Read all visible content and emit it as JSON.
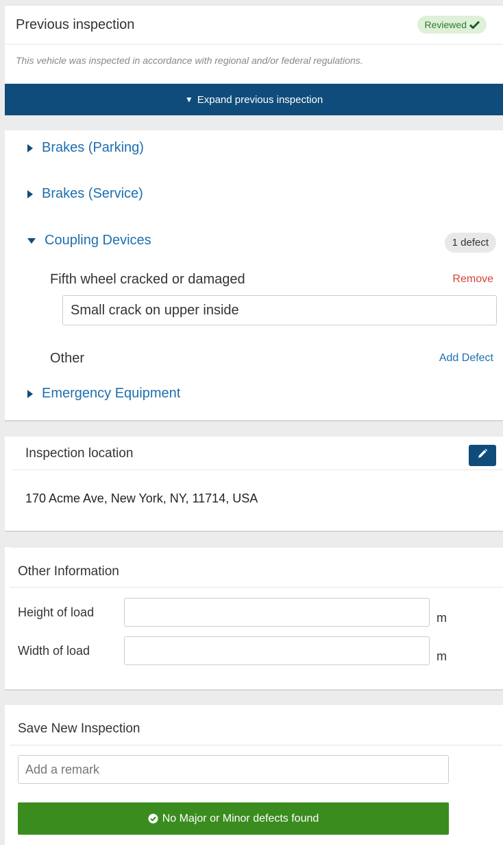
{
  "previous_inspection": {
    "title": "Previous inspection",
    "badge": "Reviewed",
    "note": "This vehicle was inspected in accordance with regional and/or federal regulations.",
    "expand_label": "Expand previous inspection",
    "expand_icon": "▼"
  },
  "categories": [
    {
      "label": "Brakes (Parking)",
      "expanded": false
    },
    {
      "label": "Brakes (Service)",
      "expanded": false
    },
    {
      "label": "Coupling Devices",
      "expanded": true,
      "defect_count": "1 defect"
    },
    {
      "label": "Emergency Equipment",
      "expanded": false
    }
  ],
  "coupling_defect": {
    "name": "Fifth wheel cracked or damaged",
    "remove_label": "Remove",
    "note_value": "Small crack on upper inside",
    "other_label": "Other",
    "add_defect_label": "Add Defect"
  },
  "location": {
    "title": "Inspection location",
    "address": "170 Acme Ave, New York, NY, 11714, USA"
  },
  "other_information": {
    "title": "Other Information",
    "fields": [
      {
        "label": "Height of load",
        "value": "",
        "unit": "m"
      },
      {
        "label": "Width of load",
        "value": "",
        "unit": "m"
      }
    ]
  },
  "save": {
    "title": "Save New Inspection",
    "remark_placeholder": "Add a remark",
    "submit_label": "No Major or Minor defects found"
  },
  "colors": {
    "primary": "#0f4c7b",
    "link": "#1d6fb0",
    "success": "#3a8c1f",
    "danger": "#d9413a",
    "badge_bg": "#dff0d8"
  }
}
